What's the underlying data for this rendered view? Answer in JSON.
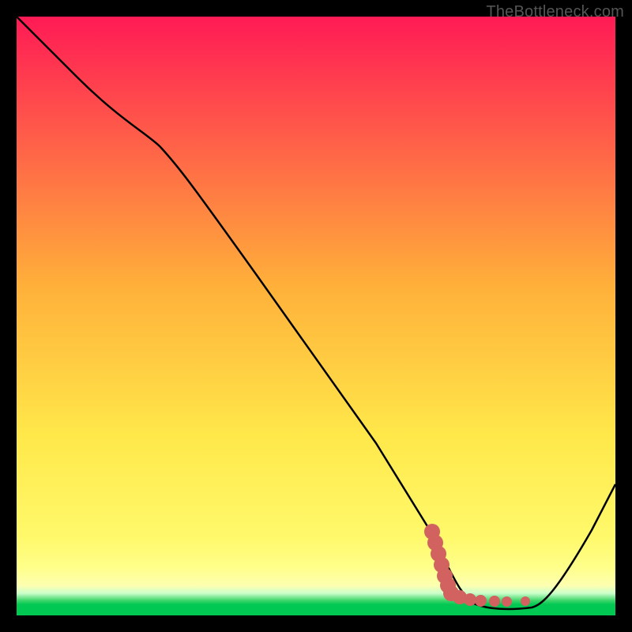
{
  "watermark": "TheBottleneck.com",
  "chart_data": {
    "type": "line",
    "title": "",
    "xlabel": "",
    "ylabel": "",
    "xlim": [
      0,
      100
    ],
    "ylim": [
      0,
      100
    ],
    "grid": false,
    "legend": false,
    "series": [
      {
        "name": "bottleneck-curve",
        "x": [
          0,
          10,
          22,
          30,
          40,
          50,
          60,
          69,
          74,
          80,
          86,
          90,
          96,
          100
        ],
        "y": [
          100,
          90,
          80,
          71,
          57,
          43,
          29,
          14,
          4,
          1,
          1,
          3,
          14,
          22
        ]
      }
    ],
    "markers": {
      "name": "highlight-dots",
      "color": "#d1625f",
      "x": [
        69,
        70,
        71,
        74,
        78,
        80,
        84
      ],
      "y": [
        14,
        9,
        5,
        3,
        2,
        2,
        2
      ]
    },
    "gradient_bands": [
      {
        "y_from": 100,
        "y_to": 8,
        "color_top": "#ff1a55",
        "color_bottom": "#ffff8a"
      },
      {
        "y_from": 8,
        "y_to": 3,
        "color_top": "#ffff8a",
        "color_bottom": "#fdffb0"
      },
      {
        "y_from": 3,
        "y_to": 0,
        "color_top": "#40d66a",
        "color_bottom": "#00c853"
      }
    ]
  }
}
